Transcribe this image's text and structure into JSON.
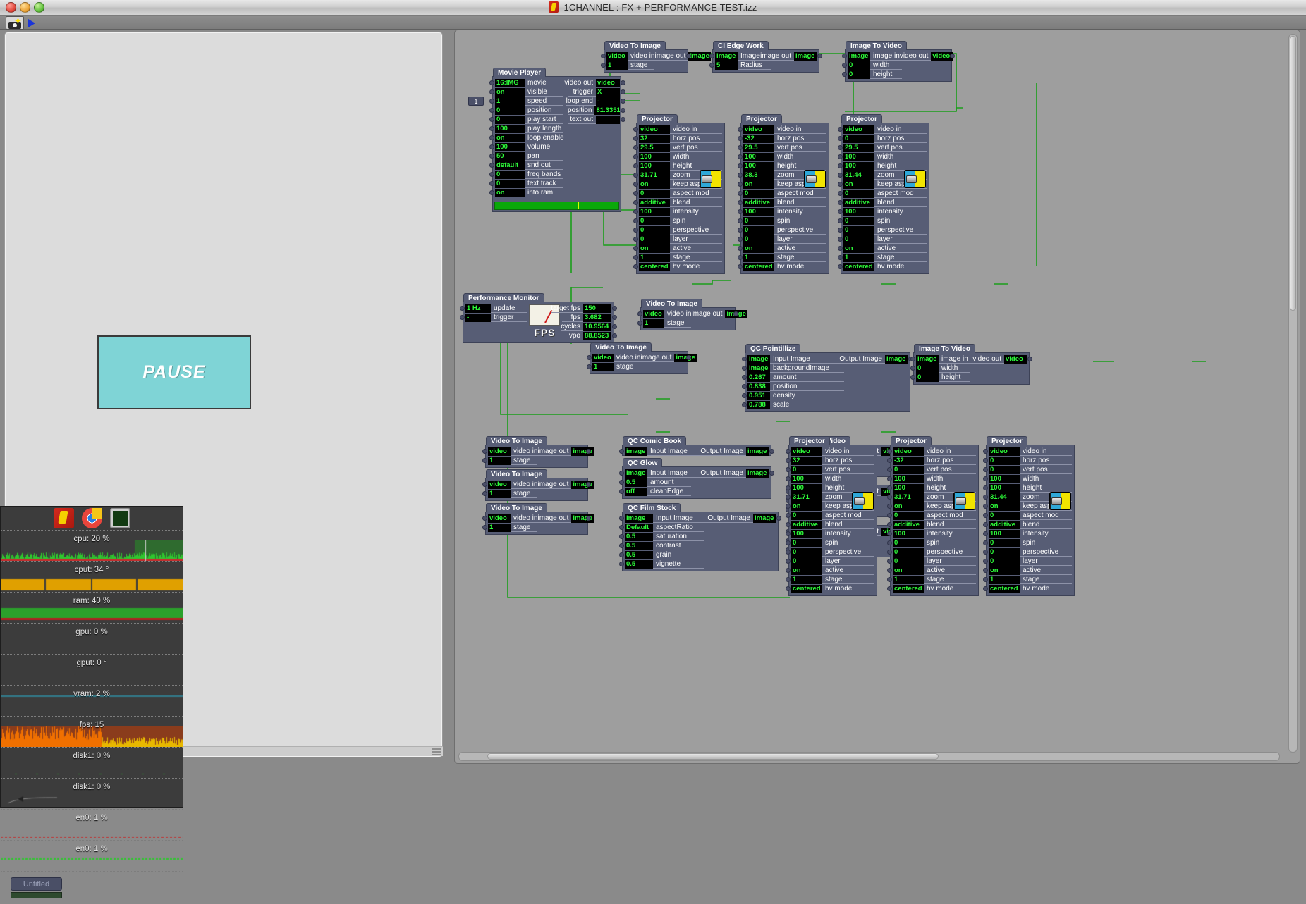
{
  "window": {
    "title": "1CHANNEL : FX + PERFORMANCE TEST.izz",
    "app_icon": "izzy-document-icon"
  },
  "toolbar": {
    "snapshot_icon": "camera-snapshot-icon",
    "play_icon": "play-triangle-icon"
  },
  "stage": {
    "pause_label": "PAUSE"
  },
  "nodes": {
    "movie_player": {
      "title": "Movie Player",
      "badge": "1",
      "inputs": [
        {
          "value": "16:IMG_",
          "label": "movie"
        },
        {
          "value": "on",
          "label": "visible"
        },
        {
          "value": "1",
          "label": "speed"
        },
        {
          "value": "0",
          "label": "position"
        },
        {
          "value": "0",
          "label": "play start"
        },
        {
          "value": "100",
          "label": "play length"
        },
        {
          "value": "on",
          "label": "loop enable"
        },
        {
          "value": "100",
          "label": "volume"
        },
        {
          "value": "50",
          "label": "pan"
        },
        {
          "value": "default",
          "label": "snd out"
        },
        {
          "value": "0",
          "label": "freq bands"
        },
        {
          "value": "0",
          "label": "text track"
        },
        {
          "value": "on",
          "label": "into ram"
        }
      ],
      "outputs": [
        {
          "label": "video out",
          "value": "video"
        },
        {
          "label": "trigger",
          "value": "X"
        },
        {
          "label": "loop end",
          "value": "-"
        },
        {
          "label": "position",
          "value": "81.3351"
        },
        {
          "label": "text out",
          "value": ""
        }
      ]
    },
    "performance_monitor": {
      "title": "Performance Monitor",
      "gauge_label": "FPS",
      "inputs": [
        {
          "value": "1 Hz",
          "label": "update"
        },
        {
          "value": "-",
          "label": "trigger"
        }
      ],
      "outputs": [
        {
          "label": "target fps",
          "value": "150"
        },
        {
          "label": "fps",
          "value": "3.682"
        },
        {
          "label": "cycles",
          "value": "10.9564"
        },
        {
          "label": "vpo",
          "value": "88.8523"
        }
      ]
    },
    "video_to_image": {
      "title": "Video To Image",
      "in_value": "video",
      "in_label": "video in",
      "stage_value": "1",
      "stage_label": "stage",
      "out_label": "image out",
      "out_value": "image"
    },
    "ci_edge_work": {
      "title": "CI Edge Work",
      "inputs": [
        {
          "value": "image",
          "label": "Image"
        },
        {
          "value": "5",
          "label": "Radius"
        }
      ],
      "out_label": "image out",
      "out_value": "image"
    },
    "image_to_video": {
      "title": "Image To Video",
      "inputs": [
        {
          "value": "image",
          "label": "image in"
        },
        {
          "value": "0",
          "label": "width"
        },
        {
          "value": "0",
          "label": "height"
        }
      ],
      "out_label": "video out",
      "out_value": "video"
    },
    "qc_pointillize": {
      "title": "QC Pointillize",
      "inputs": [
        {
          "value": "image",
          "label": "Input Image"
        },
        {
          "value": "image",
          "label": "backgroundImage"
        },
        {
          "value": "0.267",
          "label": "amount"
        },
        {
          "value": "0.838",
          "label": "position"
        },
        {
          "value": "0.951",
          "label": "density"
        },
        {
          "value": "0.788",
          "label": "scale"
        }
      ],
      "out_label": "Output Image",
      "out_value": "image"
    },
    "qc_comic_book": {
      "title": "QC Comic Book",
      "inputs": [
        {
          "value": "image",
          "label": "Input Image"
        }
      ],
      "out_label": "Output Image",
      "out_value": "image"
    },
    "qc_glow": {
      "title": "QC Glow",
      "inputs": [
        {
          "value": "image",
          "label": "Input Image"
        },
        {
          "value": "0.5",
          "label": "amount"
        },
        {
          "value": "off",
          "label": "cleanEdge"
        }
      ],
      "out_label": "Output Image",
      "out_value": "image"
    },
    "qc_film_stock": {
      "title": "QC Film Stock",
      "inputs": [
        {
          "value": "image",
          "label": "Input Image"
        },
        {
          "value": "Default",
          "label": "aspectRatio"
        },
        {
          "value": "0.5",
          "label": "saturation"
        },
        {
          "value": "0.5",
          "label": "contrast"
        },
        {
          "value": "0.5",
          "label": "grain"
        },
        {
          "value": "0.5",
          "label": "vignette"
        }
      ],
      "out_label": "Output Image",
      "out_value": "image"
    }
  },
  "projectors": [
    {
      "id": "projector-top-1",
      "title": "Projector",
      "values": [
        "video",
        "32",
        "29.5",
        "100",
        "100",
        "31.71",
        "on",
        "0",
        "additive",
        "100",
        "0",
        "0",
        "0",
        "on",
        "1",
        "centered"
      ]
    },
    {
      "id": "projector-top-2",
      "title": "Projector",
      "values": [
        "video",
        "-32",
        "29.5",
        "100",
        "100",
        "38.3",
        "on",
        "0",
        "additive",
        "100",
        "0",
        "0",
        "0",
        "on",
        "1",
        "centered"
      ]
    },
    {
      "id": "projector-top-3",
      "title": "Projector",
      "values": [
        "video",
        "0",
        "29.5",
        "100",
        "100",
        "31.44",
        "on",
        "0",
        "additive",
        "100",
        "0",
        "0",
        "0",
        "on",
        "1",
        "centered"
      ]
    },
    {
      "id": "projector-bottom-1",
      "title": "Projector",
      "values": [
        "video",
        "32",
        "0",
        "100",
        "100",
        "31.71",
        "on",
        "0",
        "additive",
        "100",
        "0",
        "0",
        "0",
        "on",
        "1",
        "centered"
      ]
    },
    {
      "id": "projector-bottom-2",
      "title": "Projector",
      "values": [
        "video",
        "-32",
        "0",
        "100",
        "100",
        "31.71",
        "on",
        "0",
        "additive",
        "100",
        "0",
        "0",
        "0",
        "on",
        "1",
        "centered"
      ]
    },
    {
      "id": "projector-bottom-3",
      "title": "Projector",
      "values": [
        "video",
        "0",
        "0",
        "100",
        "100",
        "31.44",
        "on",
        "0",
        "additive",
        "100",
        "0",
        "0",
        "0",
        "on",
        "1",
        "centered"
      ]
    }
  ],
  "projector_labels": [
    "video in",
    "horz pos",
    "vert pos",
    "width",
    "height",
    "zoom",
    "keep aspect",
    "aspect mod",
    "blend",
    "intensity",
    "spin",
    "perspective",
    "layer",
    "active",
    "stage",
    "hv mode"
  ],
  "hud": {
    "icons": [
      "izzy-app-icon",
      "chrome-icon",
      "activity-monitor-icon"
    ],
    "untitled_label": "Untitled",
    "rows": [
      {
        "label": "cpu: 20 %",
        "kind": "cpu"
      },
      {
        "label": "cput: 34 °",
        "kind": "temp"
      },
      {
        "label": "ram: 40 %",
        "kind": "ram"
      },
      {
        "label": "gpu: 0 %",
        "kind": "flat"
      },
      {
        "label": "gput: 0 °",
        "kind": "flat"
      },
      {
        "label": "vram: 2 %",
        "kind": "vram"
      },
      {
        "label": "fps: 15",
        "kind": "fps"
      },
      {
        "label": "disk1: 0 %",
        "kind": "disk"
      },
      {
        "label": "disk1: 0 %",
        "kind": "disk2"
      },
      {
        "label": "en0: 1 %",
        "kind": "net"
      },
      {
        "label": "en0: 1 %",
        "kind": "net2"
      }
    ]
  },
  "colors": {
    "node_body": "#575d75",
    "value_text": "#2dfb3a",
    "wire": "#1a9e1a",
    "stage_pause": "#7fd4d6"
  }
}
